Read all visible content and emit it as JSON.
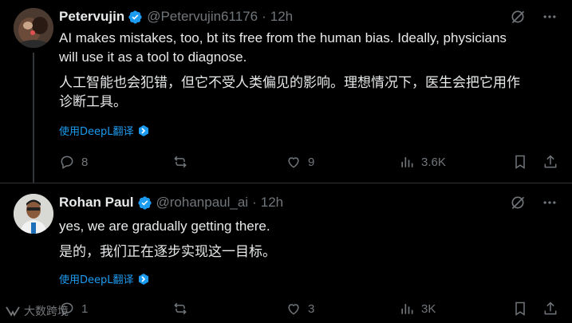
{
  "tweets": [
    {
      "name": "Petervujin",
      "handle": "@Petervujin61176",
      "separator": "·",
      "time": "12h",
      "text_en": "AI makes mistakes, too, bt its free from the human bias. Ideally, physicians\nwill use it as a tool to diagnose.",
      "text_zh": "人工智能也会犯错，但它不受人类偏见的影响。理想情况下，医生会把它用作\n诊断工具。",
      "translate_label": "使用DeepL翻译",
      "replies": "8",
      "reposts": "",
      "likes": "9",
      "views": "3.6K"
    },
    {
      "name": "Rohan Paul",
      "handle": "@rohanpaul_ai",
      "separator": "·",
      "time": "12h",
      "text_en": "yes, we are gradually getting there.",
      "text_zh": "是的，我们正在逐步实现这一目标。",
      "translate_label": "使用DeepL翻译",
      "replies": "1",
      "reposts": "",
      "likes": "3",
      "views": "3K"
    }
  ],
  "watermark": "大数跨境",
  "colors": {
    "background": "#000000",
    "text": "#e7e9ea",
    "muted": "#71767b",
    "accent": "#1d9bf0",
    "border": "#2f3336"
  },
  "icons": [
    "verified-badge-icon",
    "grok-icon",
    "more-icon",
    "translate-icon",
    "reply-icon",
    "repost-icon",
    "like-icon",
    "views-icon",
    "bookmark-icon",
    "share-icon"
  ]
}
